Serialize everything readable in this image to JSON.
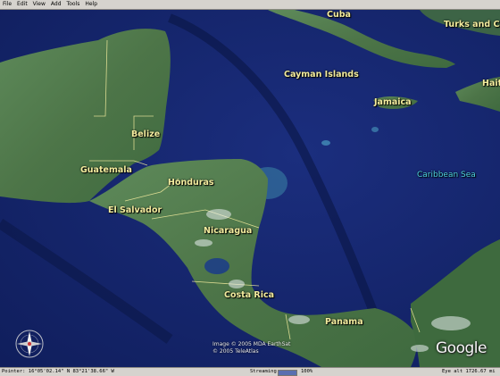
{
  "menu": [
    "File",
    "Edit",
    "View",
    "Add",
    "Tools",
    "Help"
  ],
  "labels": {
    "cuba": "Cuba",
    "turks": "Turks and Ca",
    "cayman": "Cayman Islands",
    "jamaica": "Jamaica",
    "haiti": "Haiti",
    "belize": "Belize",
    "guatemala": "Guatemala",
    "honduras": "Honduras",
    "el_salvador": "El Salvador",
    "nicaragua": "Nicaragua",
    "caribbean": "Caribbean Sea",
    "costa_rica": "Costa Rica",
    "panama": "Panama"
  },
  "credits": {
    "line1": "Image © 2005 MDA EarthSat",
    "line2": "© 2005 TeleAtlas"
  },
  "logo": "Google",
  "compass_icon": "compass-rose-icon",
  "status": {
    "pointer": "Pointer: 16°05'02.14\" N  83°21'38.66\" W",
    "streaming_label": "Streaming",
    "streaming_progress": 1.0,
    "streaming_percent": "100%",
    "eye_alt": "Eye alt  1726.67 mi"
  },
  "colors": {
    "ocean": "#16266b",
    "land": "#47704a",
    "label": "#f3ec9e",
    "sea_label": "#4fd2df"
  }
}
